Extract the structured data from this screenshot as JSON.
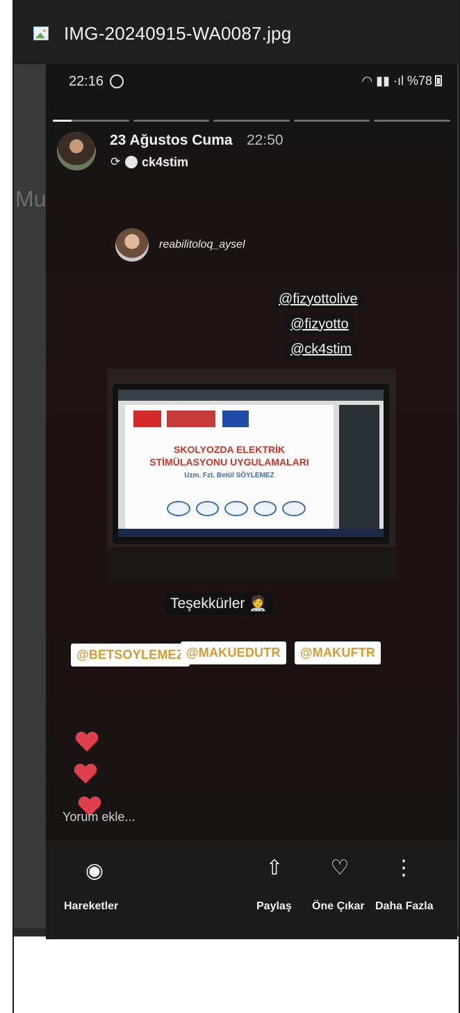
{
  "window": {
    "file_name": "IMG-20240915-WA0087.jpg",
    "background_text": "Mul"
  },
  "status_bar": {
    "time": "22:16",
    "indicators": "%78"
  },
  "story": {
    "progress_segments": [
      1,
      0,
      0,
      0,
      0
    ],
    "active_segment_progress": 0.25,
    "date": "23 Ağustos Cuma",
    "time": "22:50",
    "reposted_user": "ck4stim",
    "mention_name": "reabilitoloq_aysel",
    "tags": [
      "@fizyottolive",
      "@fizyotto",
      "@ck4stim"
    ],
    "slide": {
      "title_line1": "SKOLYOZDA ELEKTRİK",
      "title_line2": "STİMÜLASYONU UYGULAMALARI",
      "author": "Uzm. Fzt. Betül SÖYLEMEZ"
    },
    "caption": "Teşekkürler 🧑‍⚕️",
    "chips": [
      "@BETSOYLEMEZ",
      "@MAKUEDUTR",
      "@MAKUFTR"
    ],
    "reply_placeholder": "Yorum ekle..."
  },
  "bottom_bar": {
    "actions_label": "Hareketler",
    "share_label": "Paylaş",
    "highlight_label": "Öne Çıkar",
    "more_label": "Daha Fazla"
  },
  "colors": {
    "heart": "#e0404d",
    "chip_text": "#d79a2d",
    "titlebar": "#202020"
  },
  "icons": [
    "image-file-icon",
    "whatsapp-icon",
    "battery-icon",
    "repost-icon",
    "heart-icon",
    "eye-icon",
    "share-icon",
    "highlight-icon",
    "more-vertical-icon"
  ]
}
